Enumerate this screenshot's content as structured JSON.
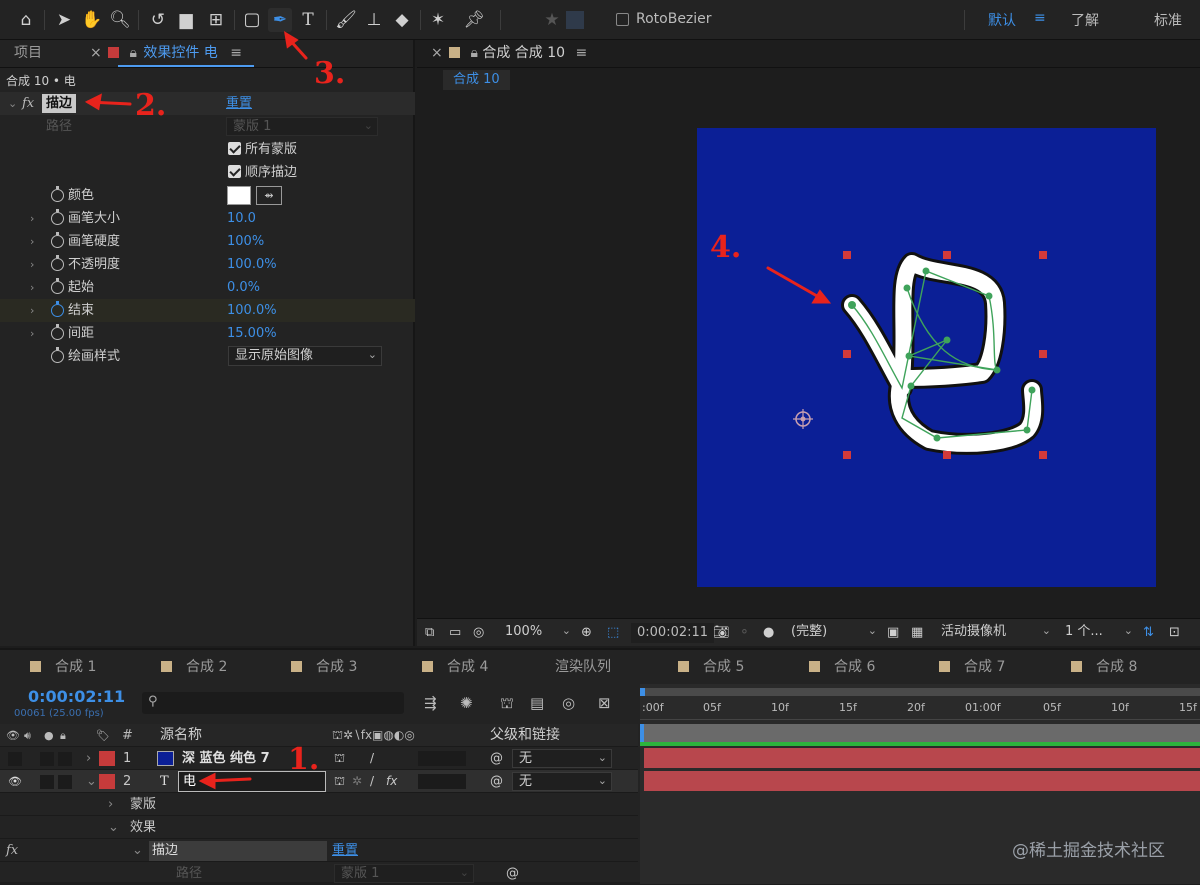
{
  "toolbar": {
    "roto_label": "RotoBezier",
    "workspaces": [
      "默认",
      "了解",
      "标准"
    ],
    "workspace_menu_icon": "≡"
  },
  "left_panel": {
    "tabs": {
      "project": "项目",
      "effect_controls": "效果控件 电",
      "menu_icon": "≡",
      "close_icon": "×"
    },
    "breadcrumb": "合成 10 • 电",
    "effect": {
      "fx_label": "fx",
      "name": "描边",
      "reset": "重置",
      "path_label": "路径",
      "path_value": "蒙版 1",
      "all_masks": "所有蒙版",
      "stroke_sequentially": "顺序描边",
      "properties": [
        {
          "label": "颜色",
          "value": ""
        },
        {
          "label": "画笔大小",
          "value": "10.0"
        },
        {
          "label": "画笔硬度",
          "value": "100%"
        },
        {
          "label": "不透明度",
          "value": "100.0%"
        },
        {
          "label": "起始",
          "value": "0.0%"
        },
        {
          "label": "结束",
          "value": "100.0%"
        },
        {
          "label": "间距",
          "value": "15.00%"
        },
        {
          "label": "绘画样式",
          "value": "显示原始图像"
        }
      ]
    }
  },
  "viewer": {
    "tab_label": "合成 合成 10",
    "sub_tab": "合成 10",
    "glyph": "电",
    "bar": {
      "zoom": "100%",
      "timecode": "0:00:02:11",
      "resolution": "(完整)",
      "camera": "活动摄像机",
      "views": "1 个..."
    }
  },
  "timeline": {
    "tabs": [
      "合成 1",
      "合成 2",
      "合成 3",
      "合成 4",
      "渲染队列",
      "合成 5",
      "合成 6",
      "合成 7",
      "合成 8"
    ],
    "timecode": "0:00:02:11",
    "frame_info": "00061 (25.00 fps)",
    "search_placeholder": "",
    "headers": {
      "num": "#",
      "source_name": "源名称",
      "parent": "父级和链接"
    },
    "layers": [
      {
        "num": "1",
        "name": "深 蓝色 纯色 7",
        "parent": "无"
      },
      {
        "num": "2",
        "name": "电",
        "parent": "无"
      }
    ],
    "sub_rows": {
      "masks": "蒙版",
      "effects": "效果",
      "stroke": "描边",
      "reset": "重置",
      "path": "路径",
      "path_value": "蒙版 1"
    },
    "ruler": [
      ":00f",
      "05f",
      "10f",
      "15f",
      "20f",
      "01:00f",
      "05f",
      "10f",
      "15f"
    ],
    "watermark": "@稀土掘金技术社区"
  },
  "annotations": [
    "1.",
    "2.",
    "3.",
    "4."
  ],
  "colors": {
    "accent_blue": "#3d8fe6",
    "canvas_blue": "#0b1f96",
    "layer_red": "#c63b3b",
    "annotation_red": "#e8231c",
    "label_tan": "#c9b187"
  }
}
